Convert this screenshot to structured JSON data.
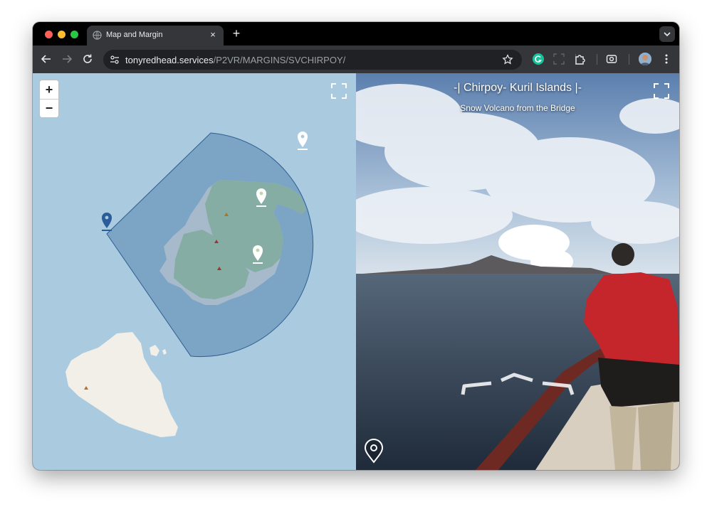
{
  "browser": {
    "tab_title": "Map and Margin",
    "tab_close": "×",
    "new_tab": "+",
    "url_host": "tonyredhead.services",
    "url_path": "/P2VR/MARGINS/SVCHIRPOY/"
  },
  "map": {
    "zoom_in_label": "+",
    "zoom_out_label": "−",
    "colors": {
      "water": "#aacbdf",
      "land": "#f2efe9",
      "park": "#b9d9a6",
      "view_cone": "#3f6fa3"
    },
    "markers": [
      {
        "name": "current-view-marker",
        "color": "#2a5d9a",
        "icon": "map-pin-icon"
      },
      {
        "name": "waypoint-marker",
        "color": "#ffffff",
        "icon": "map-pin-icon"
      }
    ]
  },
  "panorama": {
    "title": "-| Chirpoy- Kuril Islands |-",
    "subtitle": "Snow Volcano from the Bridge",
    "colors": {
      "sky": "#7f9fc4",
      "sea": "#3d4f63",
      "railing": "#6e2a22"
    }
  }
}
